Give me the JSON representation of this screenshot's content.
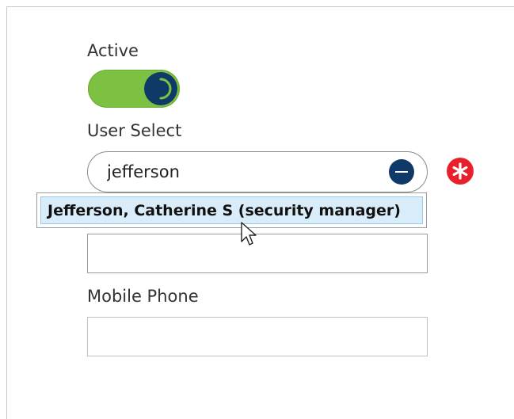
{
  "form": {
    "active_label": "Active",
    "active_value": "on",
    "user_select_label": "User Select",
    "user_select_value": "jefferson",
    "suggestion": "Jefferson, Catherine S (security manager)",
    "mobile_phone_label": "Mobile Phone",
    "hidden_field_value": "",
    "mobile_phone_value": ""
  },
  "colors": {
    "toggle_on": "#7cc142",
    "knob": "#0f3a68",
    "clear_button": "#0f3a68",
    "required_icon": "#e8202c",
    "suggestion_highlight": "#d8ecfa"
  },
  "icons": {
    "toggle_knob": "power-icon",
    "clear": "minus-circle-icon",
    "required": "asterisk-icon",
    "pointer": "mouse-pointer-icon"
  }
}
